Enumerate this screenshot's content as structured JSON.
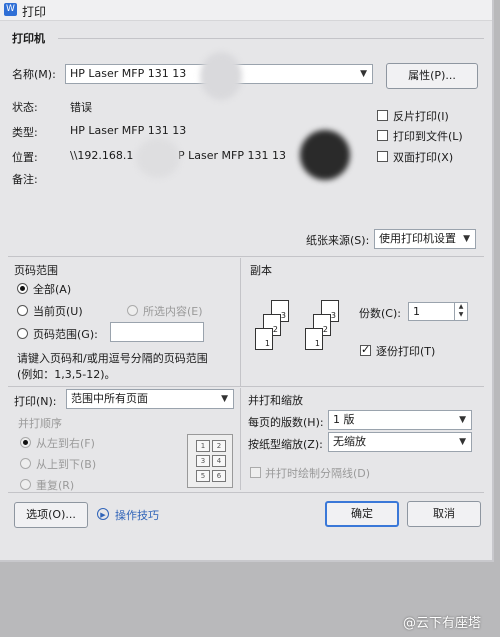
{
  "window": {
    "title": "打印",
    "icon": "printer-icon"
  },
  "printer": {
    "section_title": "打印机",
    "name_label": "名称(M):",
    "name_value": "HP Laser MFP 131 13",
    "properties_button": "属性(P)...",
    "status_label": "状态:",
    "status_value": "错误",
    "type_label": "类型:",
    "type_value": "HP Laser MFP 131 13",
    "location_label": "位置:",
    "location_value_prefix": "\\\\192.168.1",
    "location_value_suffix": "P Laser MFP 131 13",
    "comment_label": "备注:",
    "options": {
      "reverse": "反片打印(I)",
      "to_file": "打印到文件(L)",
      "duplex": "双面打印(X)"
    },
    "paper_source_label": "纸张来源(S):",
    "paper_source_value": "使用打印机设置"
  },
  "page_range": {
    "section_title": "页码范围",
    "all": "全部(A)",
    "current": "当前页(U)",
    "selection": "所选内容(E)",
    "range": "页码范围(G):",
    "range_value": "",
    "hint_line1": "请键入页码和/或用逗号分隔的页码范围",
    "hint_line2": "(例如：1,3,5-12)。"
  },
  "copies": {
    "section_title": "副本",
    "count_label": "份数(C):",
    "count_value": "1",
    "collate_label": "逐份打印(T)",
    "collate_checked": true
  },
  "print_what": {
    "label": "打印(N):",
    "value": "范围中所有页面"
  },
  "order": {
    "section_title": "并打顺序",
    "left_to_right": "从左到右(F)",
    "top_to_bottom": "从上到下(B)",
    "repeat": "重复(R)",
    "grid": [
      "1",
      "2",
      "3",
      "4",
      "5",
      "6"
    ]
  },
  "zoom": {
    "section_title": "并打和缩放",
    "pages_per_sheet_label": "每页的版数(H):",
    "pages_per_sheet_value": "1 版",
    "scale_label": "按纸型缩放(Z):",
    "scale_value": "无缩放",
    "draw_lines_label": "并打时绘制分隔线(D)"
  },
  "footer": {
    "options_button": "选项(O)...",
    "tips_link": "操作技巧",
    "ok_button": "确定",
    "cancel_button": "取消"
  },
  "watermark": "@云下有座塔"
}
